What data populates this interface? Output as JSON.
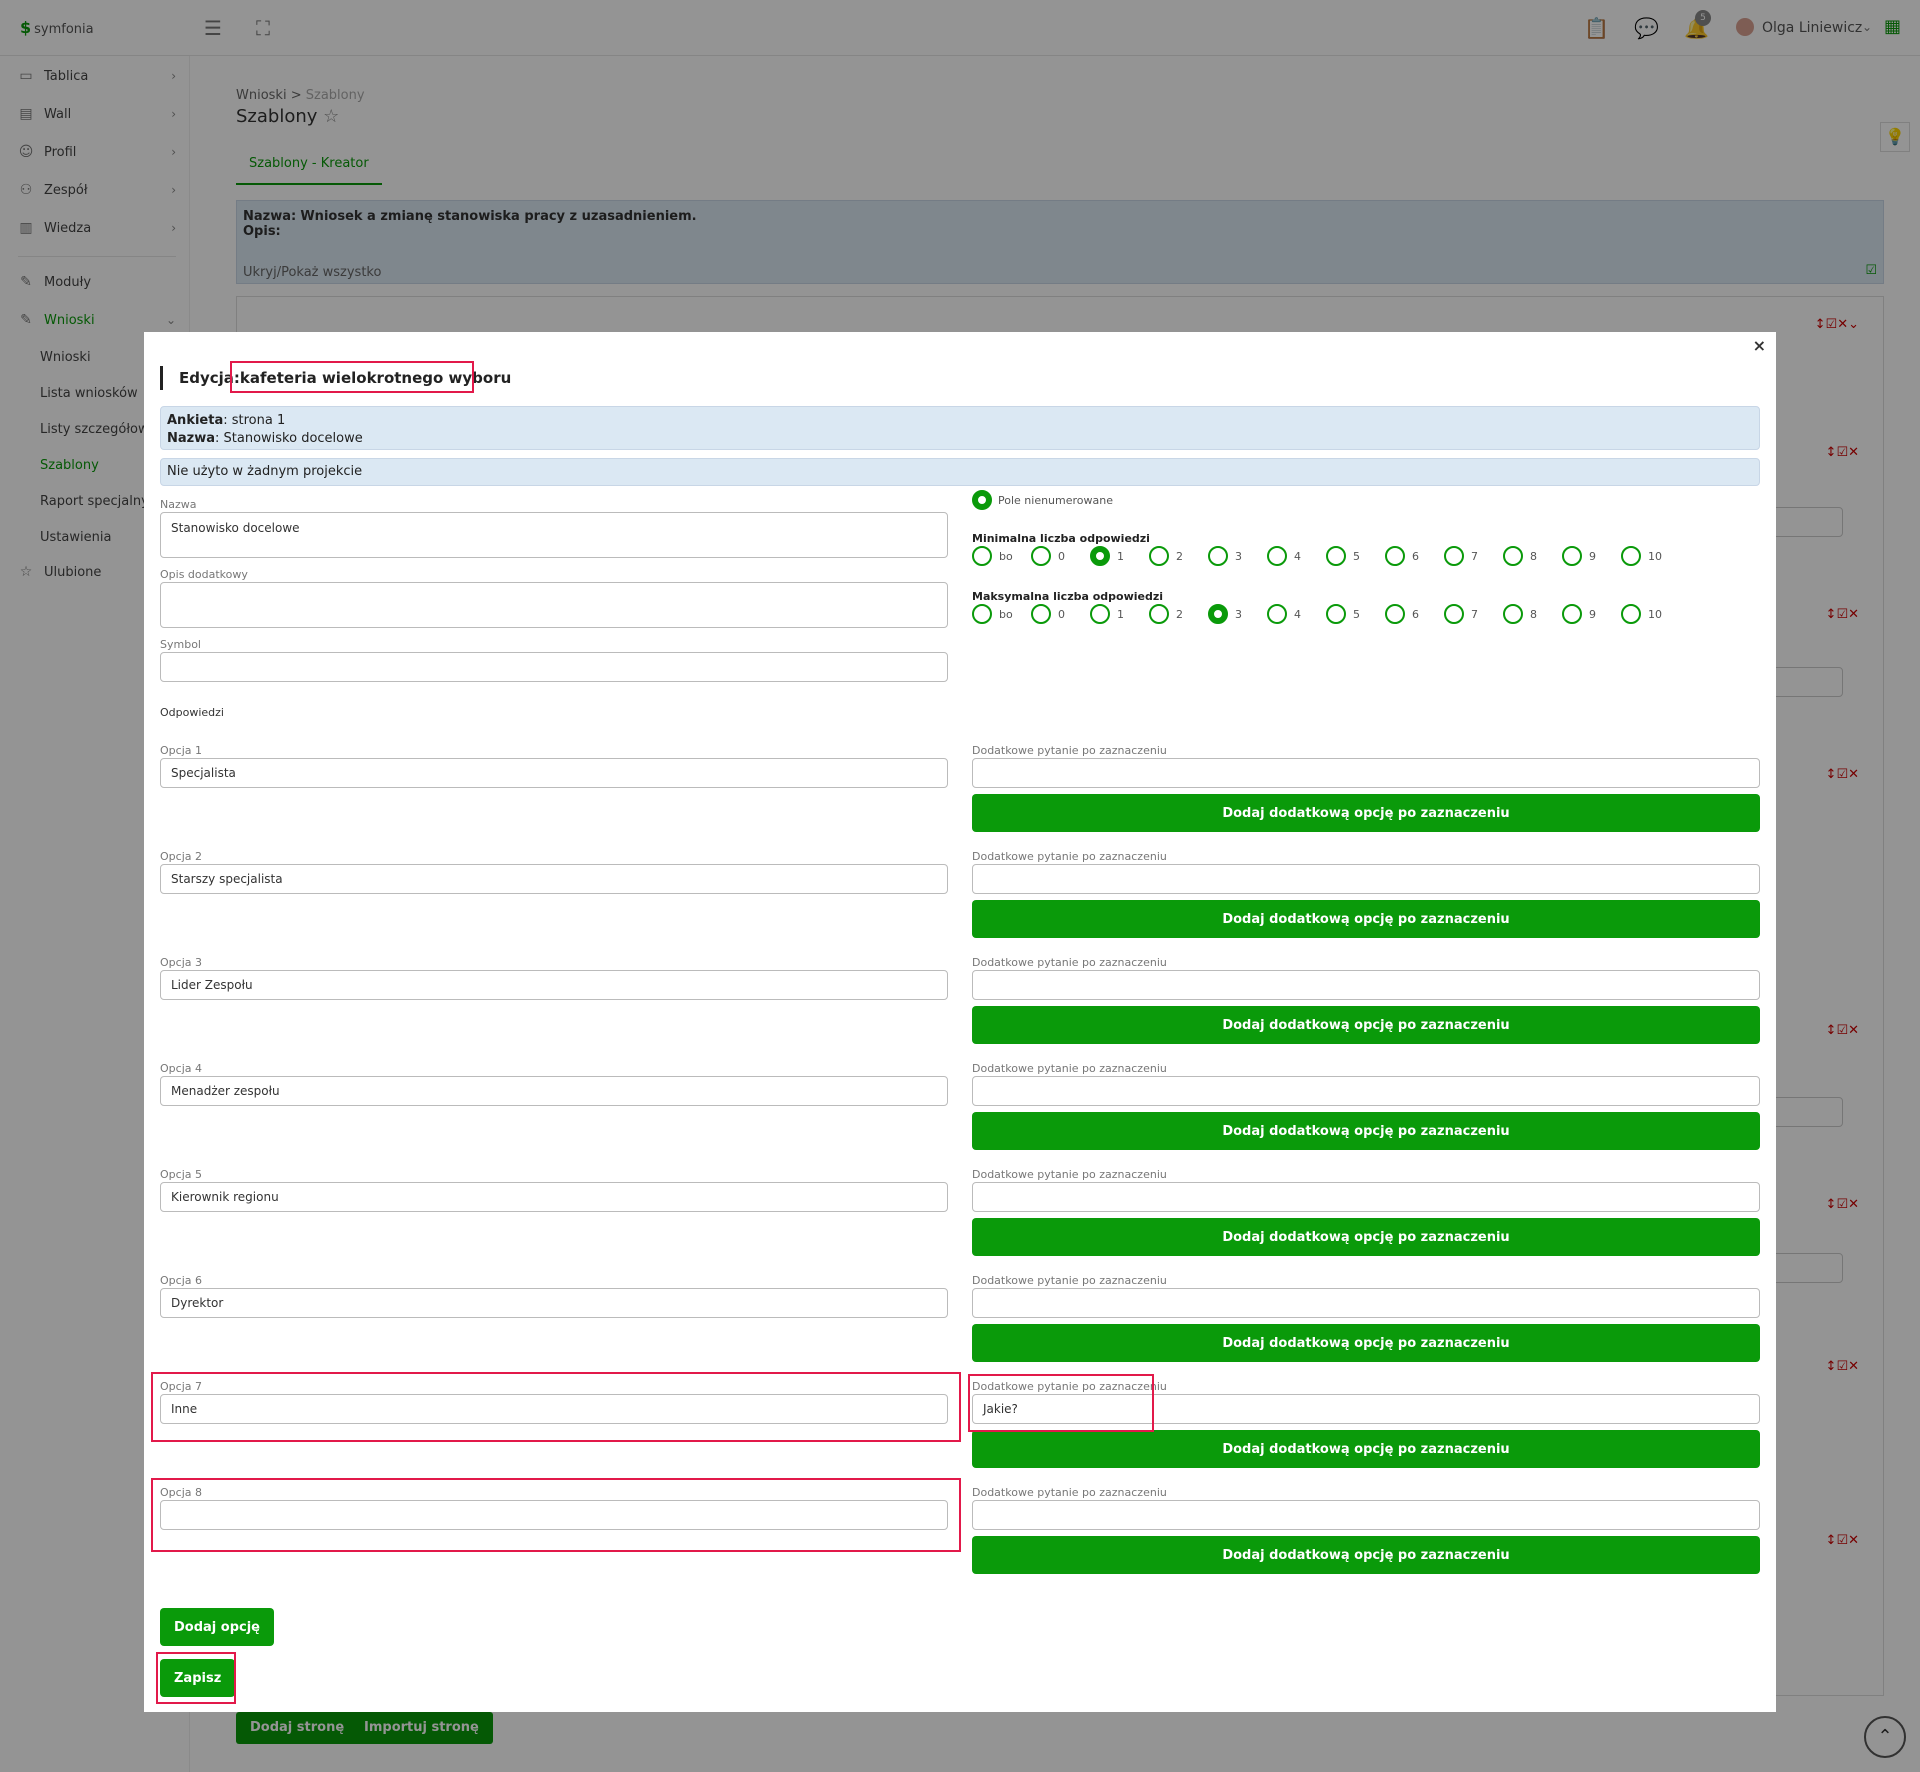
{
  "app": {
    "logo": "symfonia"
  },
  "header": {
    "user_name": "Olga Liniewicz",
    "notifications_count": "5"
  },
  "sidebar": {
    "items": [
      {
        "label": "Tablica",
        "icon": "monitor-icon"
      },
      {
        "label": "Wall",
        "icon": "wall-icon"
      },
      {
        "label": "Profil",
        "icon": "user-icon"
      },
      {
        "label": "Zespół",
        "icon": "team-icon"
      },
      {
        "label": "Wiedza",
        "icon": "book-icon"
      }
    ],
    "modules": "Moduły",
    "wnioski": "Wnioski",
    "sub": [
      "Wnioski",
      "Lista wniosków",
      "Listy szczegółowe",
      "Szablony",
      "Raport specjalny",
      "Ustawienia"
    ],
    "favorites": "Ulubione"
  },
  "page": {
    "breadcrumb_root": "Wnioski",
    "breadcrumb_sep": ">",
    "breadcrumb_current": "Szablony",
    "title": "Szablony",
    "tab": "Szablony - Kreator",
    "info_name_label": "Nazwa:",
    "info_name_value": "Wniosek a zmianę stanowiska pracy z uzasadnieniem.",
    "info_desc_label": "Opis:",
    "info_toggle": "Ukryj/Pokaż wszystko",
    "btn_add_page": "Dodaj stronę",
    "btn_import_page": "Importuj stronę"
  },
  "modal": {
    "title_prefix": "Edycja:",
    "title_value": "kafeteria wielokrotnego wyboru",
    "ankieta_label": "Ankieta",
    "ankieta_value": ": strona 1",
    "nazwa_label": "Nazwa",
    "nazwa_value": ": Stanowisko docelowe",
    "usage": "Nie użyto w żadnym projekcie",
    "field_nazwa_label": "Nazwa",
    "field_nazwa_value": "Stanowisko docelowe",
    "field_opis_label": "Opis dodatkowy",
    "field_opis_value": "",
    "field_symbol_label": "Symbol",
    "field_symbol_value": "",
    "unnumbered_label": "Pole nienumerowane",
    "min_label": "Minimalna liczba odpowiedzi",
    "max_label": "Maksymalna liczba odpowiedzi",
    "count_options": [
      "bo",
      "0",
      "1",
      "2",
      "3",
      "4",
      "5",
      "6",
      "7",
      "8",
      "9",
      "10"
    ],
    "min_selected": "1",
    "max_selected": "3",
    "answers_label": "Odpowiedzi",
    "extra_question_label": "Dodatkowe pytanie po zaznaczeniu",
    "add_extra_button": "Dodaj dodatkową opcję po zaznaczeniu",
    "options": [
      {
        "label": "Opcja 1",
        "value": "Specjalista",
        "extra": ""
      },
      {
        "label": "Opcja 2",
        "value": "Starszy specjalista",
        "extra": ""
      },
      {
        "label": "Opcja 3",
        "value": "Lider Zespołu",
        "extra": ""
      },
      {
        "label": "Opcja 4",
        "value": "Menadżer zespołu",
        "extra": ""
      },
      {
        "label": "Opcja 5",
        "value": "Kierownik regionu",
        "extra": ""
      },
      {
        "label": "Opcja 6",
        "value": "Dyrektor",
        "extra": ""
      },
      {
        "label": "Opcja 7",
        "value": "Inne",
        "extra": "Jakie?"
      },
      {
        "label": "Opcja 8",
        "value": "",
        "extra": ""
      }
    ],
    "add_option_button": "Dodaj opcję",
    "save_button": "Zapisz",
    "close": "×"
  },
  "colors": {
    "accent": "#0a9a0a",
    "highlight": "#e2194a",
    "info_bg": "#dbe8f3"
  }
}
